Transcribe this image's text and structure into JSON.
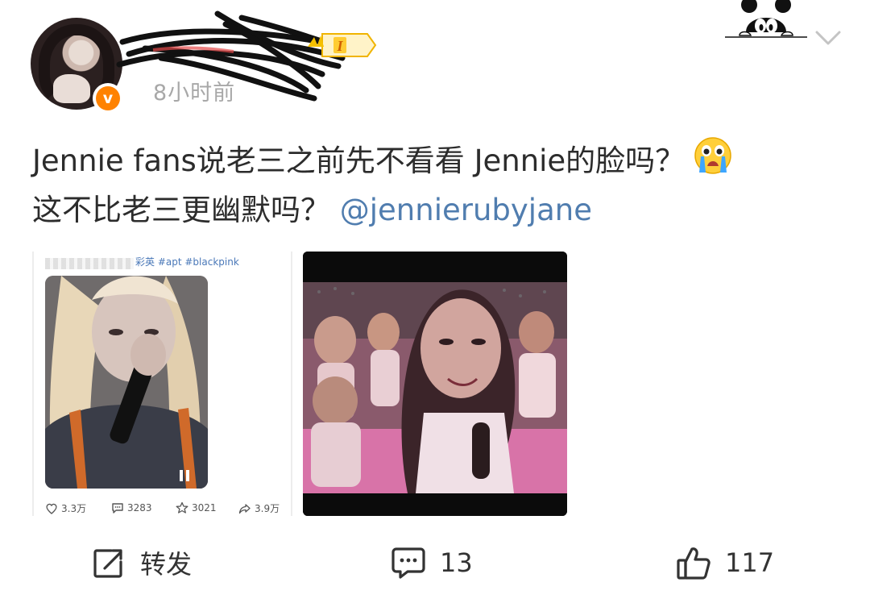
{
  "post": {
    "timestamp": "8小时前",
    "text_line1_part1": "Jennie fans说老三之前先不看看 Jennie的脸吗？",
    "text_line2_part1": "这不比老三更幽默吗？",
    "mention": "@jennierubyjane",
    "emoji": "crying-face-emoji"
  },
  "images": {
    "card1": {
      "caption": "彩英 #apt #blackpink",
      "stats": {
        "likes": "3.3万",
        "comments": "3283",
        "favorites": "3021",
        "shares": "3.9万"
      }
    }
  },
  "actions": {
    "repost_label": "转发",
    "comment_count": "13",
    "like_count": "117"
  },
  "colors": {
    "mention": "#507daf",
    "verified": "#ff8200",
    "timestamp": "#a8a8a8"
  }
}
